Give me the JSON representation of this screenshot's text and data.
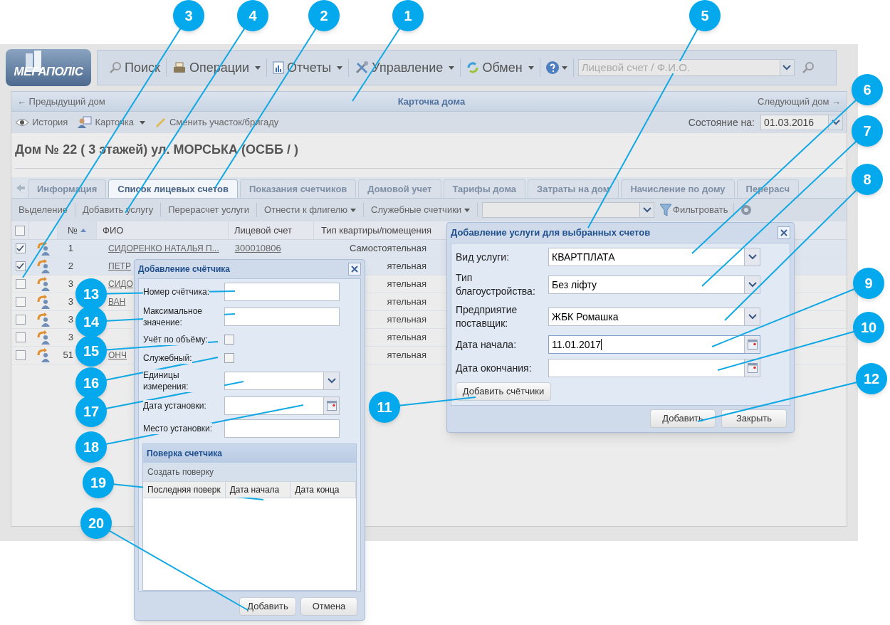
{
  "logo": {
    "text": "МЕГАПОЛІС"
  },
  "main_menu": [
    {
      "label": "Поиск",
      "has_menu": false
    },
    {
      "label": "Операции",
      "has_menu": true
    },
    {
      "label": "Отчеты",
      "has_menu": true
    },
    {
      "label": "Управление",
      "has_menu": true
    },
    {
      "label": "Обмен",
      "has_menu": true
    }
  ],
  "search": {
    "placeholder": "Лицевой счет / Ф.И.О."
  },
  "nav": {
    "previous": "← Предыдущий дом",
    "title": "Карточка дома",
    "next": "Следующий дом →"
  },
  "card_toolbar": [
    {
      "label": "История",
      "has_menu": false
    },
    {
      "label": "Карточка",
      "has_menu": true
    },
    {
      "label": "Сменить участок/бригаду",
      "has_menu": false
    }
  ],
  "state_date": {
    "label": "Состояние на:",
    "value": "01.03.2016"
  },
  "house_title": "Дом № 22 ( 3 этажей) ул. МОРСЬКА (ОСББ / )",
  "tabs": [
    {
      "label": "Информация",
      "selected": false
    },
    {
      "label": "Список лицевых счетов",
      "selected": true
    },
    {
      "label": "Показания счетчиков",
      "selected": false
    },
    {
      "label": "Домовой учет",
      "selected": false
    },
    {
      "label": "Тарифы дома",
      "selected": false
    },
    {
      "label": "Затраты на дом",
      "selected": false
    },
    {
      "label": "Начисление по дому",
      "selected": false
    },
    {
      "label": "Перерасч",
      "selected": false
    }
  ],
  "grid_toolbar": [
    {
      "label": "Выделение",
      "has_menu": false
    },
    {
      "label": "Добавить услугу",
      "has_menu": false
    },
    {
      "label": "Перерасчет услуги",
      "has_menu": false
    },
    {
      "label": "Отнести к флигелю",
      "has_menu": true
    },
    {
      "label": "Служебные счетчики",
      "has_menu": true
    }
  ],
  "filter_button": "Фильтровать",
  "table": {
    "all_checked": false,
    "columns": [
      "№",
      "ФИО",
      "Лицевой счет",
      "Тип квартиры/помещения"
    ],
    "rows": [
      {
        "checked": true,
        "number": "1",
        "name": "СИДОРЕНКО НАТАЛЬЯ П...",
        "account": "300010806",
        "type": "Самостоятельная"
      },
      {
        "checked": true,
        "number": "2",
        "name": "ПЕТР",
        "type": "ятельная"
      },
      {
        "checked": false,
        "number": "3",
        "name": "СИДО",
        "type": "ятельная"
      },
      {
        "checked": false,
        "number": "3",
        "name": "ВАН",
        "type": "ятельная"
      },
      {
        "checked": false,
        "number": "3",
        "type": "ятельная"
      },
      {
        "checked": false,
        "number": "3",
        "type": "ятельная"
      },
      {
        "checked": false,
        "number": "51",
        "name": "ОНЧ",
        "type": "ятельная"
      }
    ]
  },
  "service_dialog": {
    "title": "Добавление услуги для выбранных счетов",
    "fields": [
      {
        "kind": "combo",
        "label": "Вид услуги:",
        "value": "КВАРТПЛАТА",
        "focused": false
      },
      {
        "kind": "combo",
        "label": "Тип благоустройства:",
        "value": "Без ліфту",
        "focused": false
      },
      {
        "kind": "combo",
        "label": "Предприятие поставщик:",
        "value": "ЖБК Ромашка",
        "focused": false
      },
      {
        "kind": "date",
        "label": "Дата начала:",
        "value": "11.01.2017",
        "focused": true
      },
      {
        "kind": "date",
        "label": "Дата окончания:",
        "focused": false
      }
    ],
    "add_meters_button": "Добавить счётчики",
    "buttons": [
      "Добавить",
      "Закрыть"
    ]
  },
  "meter_dialog": {
    "title": "Добавление счётчика",
    "fields": [
      {
        "kind": "text",
        "label": "Номер счётчика:"
      },
      {
        "kind": "text",
        "label": "Максимальное значение:"
      },
      {
        "kind": "checkbox",
        "label": "Учёт по объёму:",
        "checked": false
      },
      {
        "kind": "checkbox",
        "label": "Служебный:",
        "checked": false
      },
      {
        "kind": "combo",
        "label": "Единицы измерения:"
      },
      {
        "kind": "date",
        "label": "Дата установки:"
      },
      {
        "kind": "text",
        "label": "Место установки:"
      }
    ],
    "section": {
      "title": "Поверка счетчика",
      "action": "Создать поверку",
      "columns": [
        "Последняя поверк",
        "Дата начала",
        "Дата конца"
      ]
    },
    "buttons": [
      "Добавить",
      "Отмена"
    ]
  },
  "callouts": [
    {
      "number": "3"
    },
    {
      "number": "4"
    },
    {
      "number": "2"
    },
    {
      "number": "1"
    },
    {
      "number": "5"
    },
    {
      "number": "6"
    },
    {
      "number": "7"
    },
    {
      "number": "8"
    },
    {
      "number": "9"
    },
    {
      "number": "10"
    },
    {
      "number": "11"
    },
    {
      "number": "12"
    },
    {
      "number": "13"
    },
    {
      "number": "14"
    },
    {
      "number": "15"
    },
    {
      "number": "16"
    },
    {
      "number": "17"
    },
    {
      "number": "18"
    },
    {
      "number": "19"
    },
    {
      "number": "20"
    }
  ]
}
